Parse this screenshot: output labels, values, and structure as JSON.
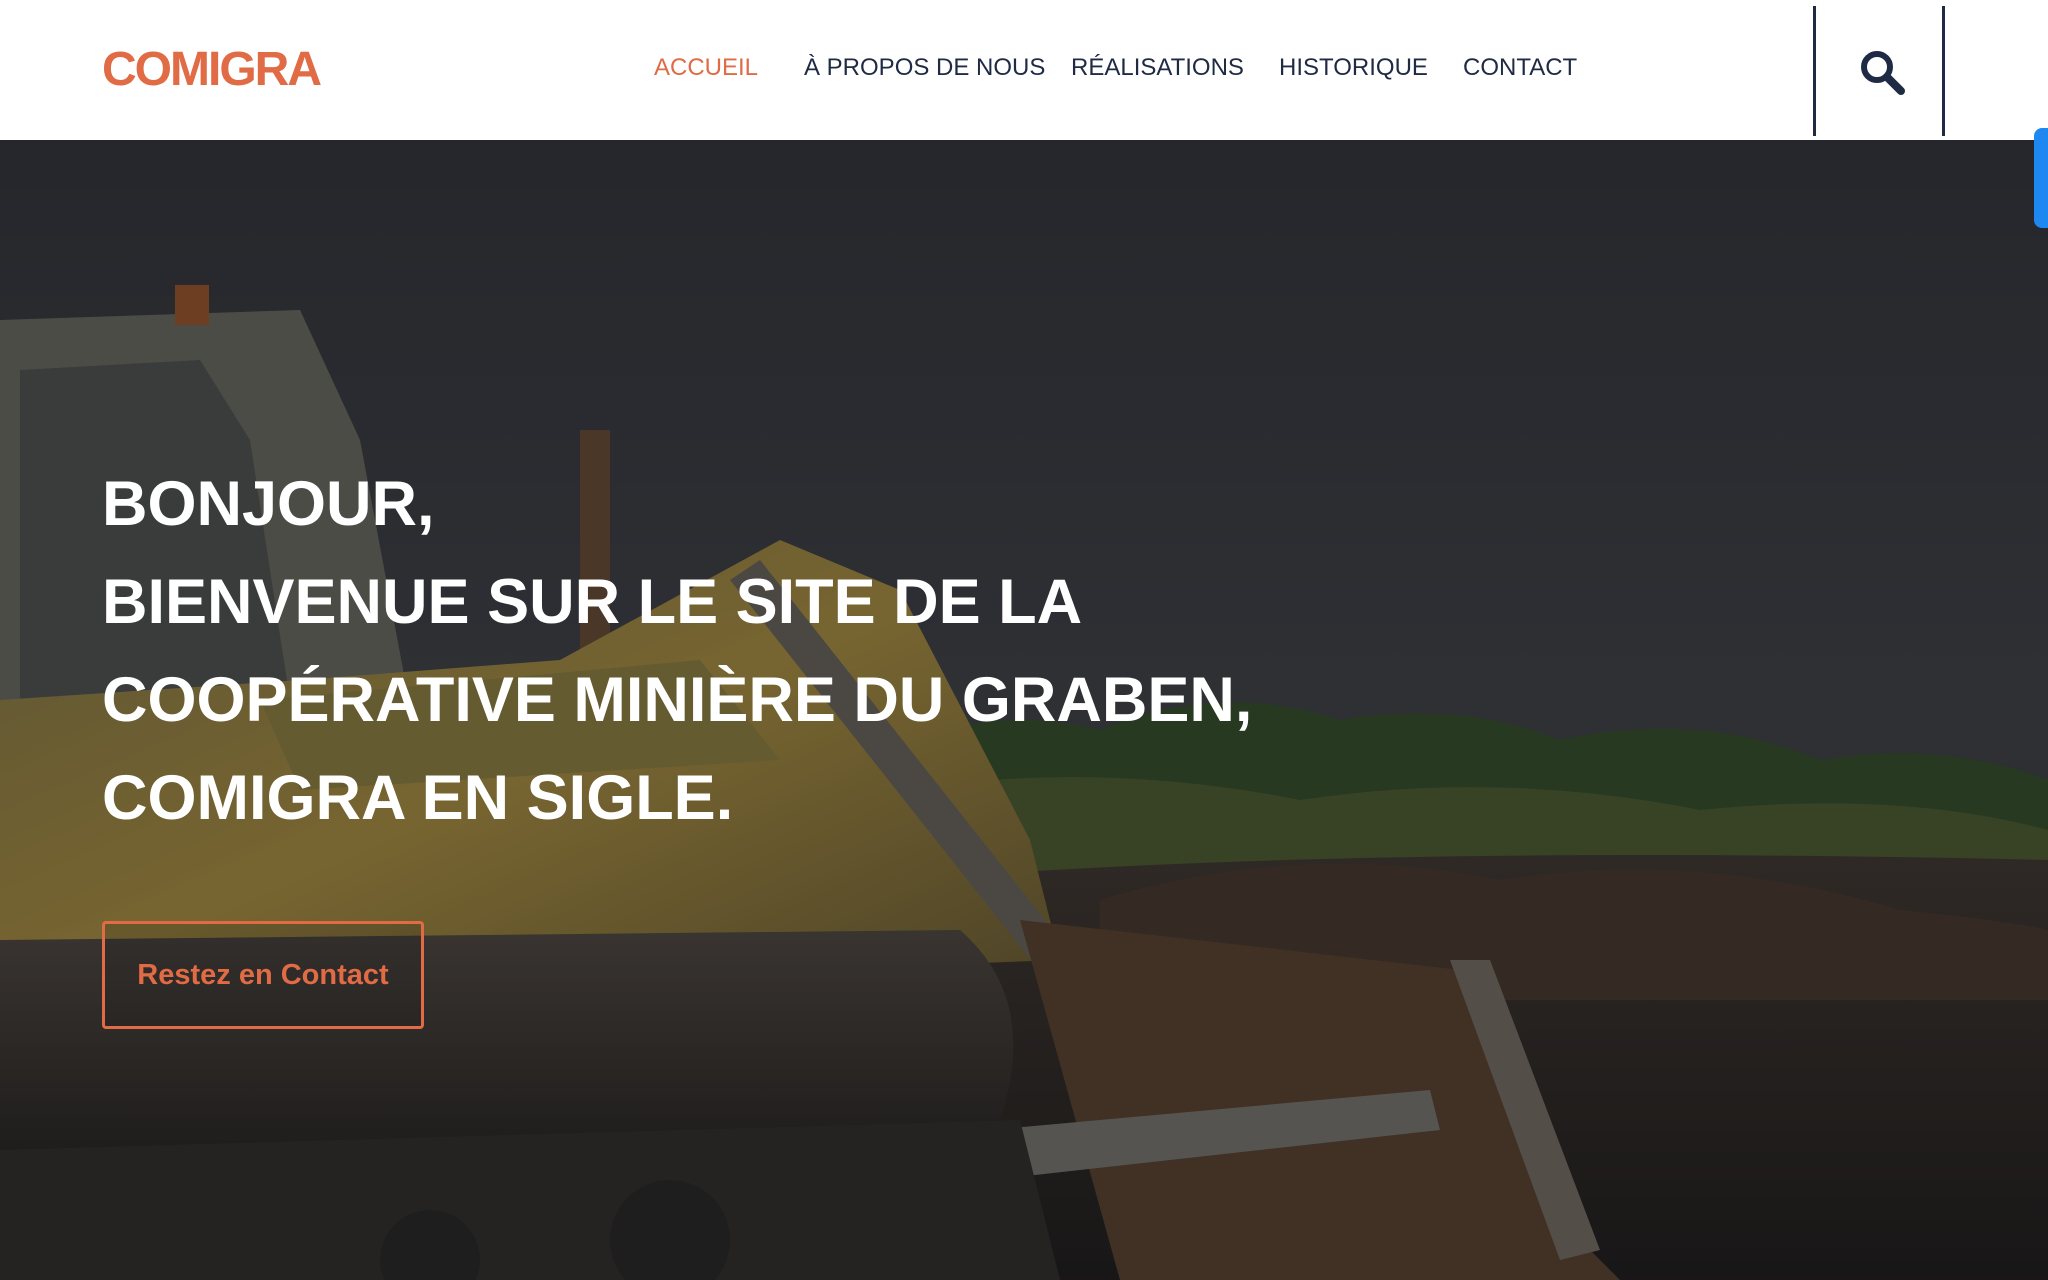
{
  "brand": {
    "logo_text": "COMIGRA",
    "accent_color": "#e06b45"
  },
  "nav": {
    "items": [
      {
        "label": "ACCUEIL",
        "active": true
      },
      {
        "label": "À PROPOS DE NOUS",
        "active": false
      },
      {
        "label": "RÉALISATIONS",
        "active": false
      },
      {
        "label": "HISTORIQUE",
        "active": false
      },
      {
        "label": "CONTACT",
        "active": false
      }
    ],
    "search_icon": "search-icon"
  },
  "hero": {
    "lines": [
      "BONJOUR,",
      "BIENVENUE SUR LE SITE DE LA",
      "COOPÉRATIVE MINIÈRE DU GRABEN,",
      "COMIGRA EN SIGLE."
    ],
    "cta_label": "Restez en Contact",
    "background": "bulldozer-photo"
  }
}
